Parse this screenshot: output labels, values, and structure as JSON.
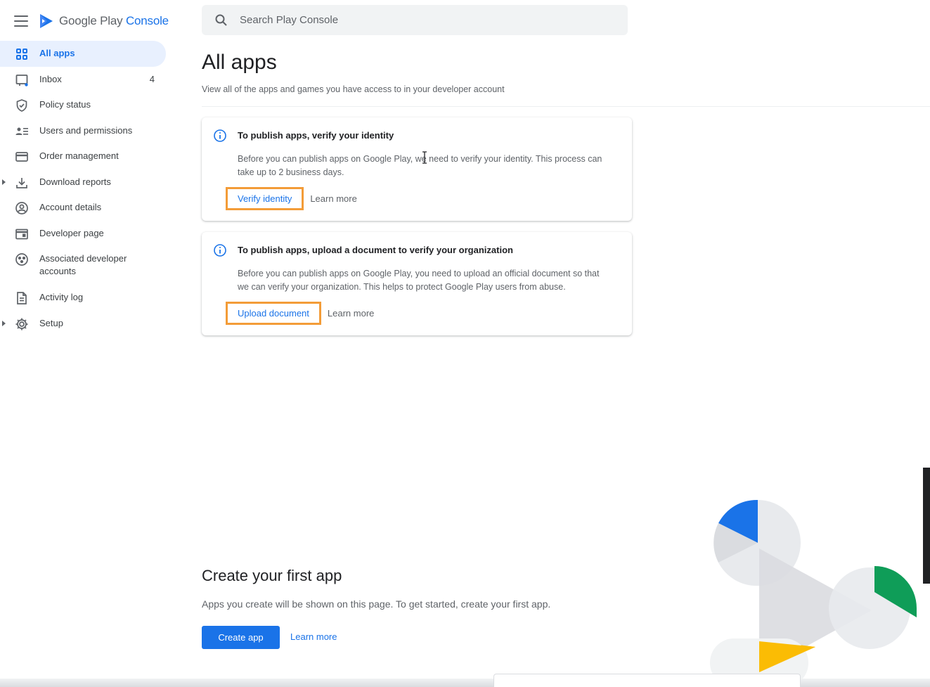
{
  "brand": {
    "name_prefix": "Google Play",
    "name_accent": "Console"
  },
  "search": {
    "placeholder": "Search Play Console"
  },
  "sidebar": {
    "items": [
      {
        "label": "All apps",
        "icon": "grid-icon",
        "active": true
      },
      {
        "label": "Inbox",
        "icon": "inbox-icon",
        "count": "4"
      },
      {
        "label": "Policy status",
        "icon": "shield-icon"
      },
      {
        "label": "Users and permissions",
        "icon": "users-icon"
      },
      {
        "label": "Order management",
        "icon": "credit-card-icon"
      },
      {
        "label": "Download reports",
        "icon": "download-icon",
        "expandable": true
      },
      {
        "label": "Account details",
        "icon": "account-circle-icon"
      },
      {
        "label": "Developer page",
        "icon": "web-page-icon"
      },
      {
        "label": "Associated developer accounts",
        "icon": "associated-accounts-icon"
      },
      {
        "label": "Activity log",
        "icon": "document-icon"
      },
      {
        "label": "Setup",
        "icon": "gear-icon",
        "expandable": true
      }
    ]
  },
  "main": {
    "title": "All apps",
    "subtitle": "View all of the apps and games you have access to in your developer account",
    "cards": [
      {
        "title": "To publish apps, verify your identity",
        "body": "Before you can publish apps on Google Play, we need to verify your identity. This process can take up to 2 business days.",
        "primary": "Verify identity",
        "secondary": "Learn more"
      },
      {
        "title": "To publish apps, upload a document to verify your organization",
        "body": "Before you can publish apps on Google Play, you need to upload an official document so that we can verify your organization. This helps to protect Google Play users from abuse.",
        "primary": "Upload document",
        "secondary": "Learn more"
      }
    ],
    "create": {
      "title": "Create your first app",
      "body": "Apps you create will be shown on this page. To get started, create your first app.",
      "button": "Create app",
      "link": "Learn more"
    }
  },
  "colors": {
    "accent": "#1a73e8",
    "highlight_outline": "#f39c38",
    "active_nav_bg": "#e8f0fe",
    "deco_blue": "#1a73e8",
    "deco_green": "#0f9d58",
    "deco_yellow": "#fbbc04"
  }
}
